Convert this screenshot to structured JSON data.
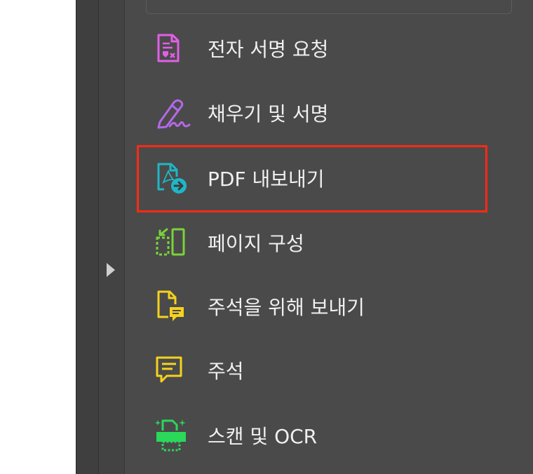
{
  "tools": {
    "request_signature": {
      "label": "전자 서명 요청",
      "icon": "signature-request-icon",
      "color": "#e35ee8"
    },
    "fill_sign": {
      "label": "채우기 및 서명",
      "icon": "pen-sign-icon",
      "color": "#b468e8"
    },
    "export_pdf": {
      "label": "PDF 내보내기",
      "icon": "export-pdf-icon",
      "color": "#1fb7c7"
    },
    "organize_pages": {
      "label": "페이지 구성",
      "icon": "organize-pages-icon",
      "color": "#79d33a"
    },
    "send_comments": {
      "label": "주석을 위해 보내기",
      "icon": "send-for-comments-icon",
      "color": "#f6d21c"
    },
    "comment": {
      "label": "주석",
      "icon": "comment-icon",
      "color": "#f6d21c"
    },
    "scan_ocr": {
      "label": "스캔 및 OCR",
      "icon": "scan-ocr-icon",
      "color": "#2ad85a"
    }
  },
  "highlight_color": "#ff2a14"
}
